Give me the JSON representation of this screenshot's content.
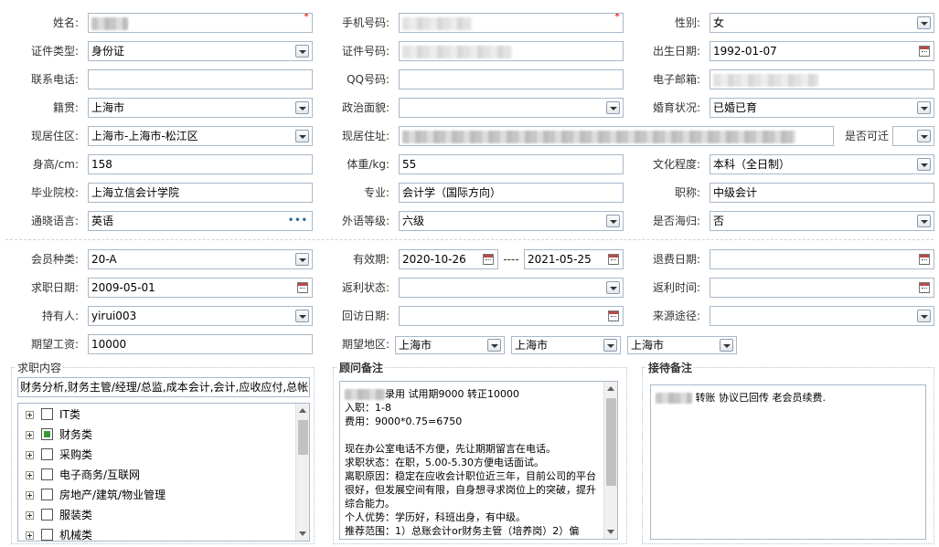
{
  "row1": {
    "name_label": "姓名:",
    "name_required": "*",
    "phone_label": "手机号码:",
    "phone_required": "*",
    "gender_label": "性别:",
    "gender_value": "女"
  },
  "row2": {
    "idtype_label": "证件类型:",
    "idtype_value": "身份证",
    "idno_label": "证件号码:",
    "birth_label": "出生日期:",
    "birth_value": "1992-01-07"
  },
  "row3": {
    "contact_label": "联系电话:",
    "qq_label": "QQ号码:",
    "email_label": "电子邮箱:"
  },
  "row4": {
    "native_label": "籍贯:",
    "native_value": "上海市",
    "political_label": "政治面貌:",
    "marital_label": "婚育状况:",
    "marital_value": "已婚已育"
  },
  "row5": {
    "district_label": "现居住区:",
    "district_value": "上海市-上海市-松江区",
    "address_label": "现居住址:",
    "relocate_label": "是否可迁"
  },
  "row6": {
    "height_label": "身高/cm:",
    "height_value": "158",
    "weight_label": "体重/kg:",
    "weight_value": "55",
    "education_label": "文化程度:",
    "education_value": "本科（全日制）"
  },
  "row7": {
    "school_label": "毕业院校:",
    "school_value": "上海立信会计学院",
    "major_label": "专业:",
    "major_value": "会计学（国际方向）",
    "title_label": "职称:",
    "title_value": "中级会计"
  },
  "row8": {
    "lang_label": "通晓语言:",
    "lang_value": "英语",
    "foreign_label": "外语等级:",
    "foreign_value": "六级",
    "overseas_label": "是否海归:",
    "overseas_value": "否"
  },
  "row9": {
    "member_label": "会员种类:",
    "member_value": "20-A",
    "valid_label": "有效期:",
    "valid_from": "2020-10-26",
    "valid_sep": "----",
    "valid_to": "2021-05-25",
    "refund_label": "退费日期:"
  },
  "row10": {
    "jobdate_label": "求职日期:",
    "jobdate_value": "2009-05-01",
    "rebate_status_label": "返利状态:",
    "rebate_time_label": "返利时间:"
  },
  "row11": {
    "holder_label": "持有人:",
    "holder_value": "yirui003",
    "visit_label": "回访日期:",
    "source_label": "来源途径:"
  },
  "row12": {
    "salary_label": "期望工资:",
    "salary_value": "10000",
    "region_label": "期望地区:",
    "region1": "上海市",
    "region2": "上海市",
    "region3": "上海市"
  },
  "job_content": {
    "title": "求职内容",
    "summary": "财务分析,财务主管/经理/总监,成本会计,会计,应收应付,总帐",
    "tree": [
      {
        "label": "IT类",
        "checked": false
      },
      {
        "label": "财务类",
        "checked": true
      },
      {
        "label": "采购类",
        "checked": false
      },
      {
        "label": "电子商务/互联网",
        "checked": false
      },
      {
        "label": "房地产/建筑/物业管理",
        "checked": false
      },
      {
        "label": "服装类",
        "checked": false
      },
      {
        "label": "机械类",
        "checked": false
      }
    ]
  },
  "advisor_notes": {
    "title": "顾问备注",
    "line1": "录用 试用期9000 转正10000",
    "body": "入职：1-8\n费用：9000*0.75=6750\n\n现在办公室电话不方便，先让期期留言在电话。\n求职状态：在职，5.00-5.30方便电话面试。\n离职原因：稳定在应收会计职位近三年，目前公司的平台很好，但发展空间有限，自身想寻求岗位上的突破，提升综合能力。\n个人优势：学历好，科班出身，有中级。\n推荐范围：1）总账会计or财务主管（培养岗）2）偏"
  },
  "reception_notes": {
    "title": "接待备注",
    "text": " 转账 协议已回传 老会员续费."
  }
}
